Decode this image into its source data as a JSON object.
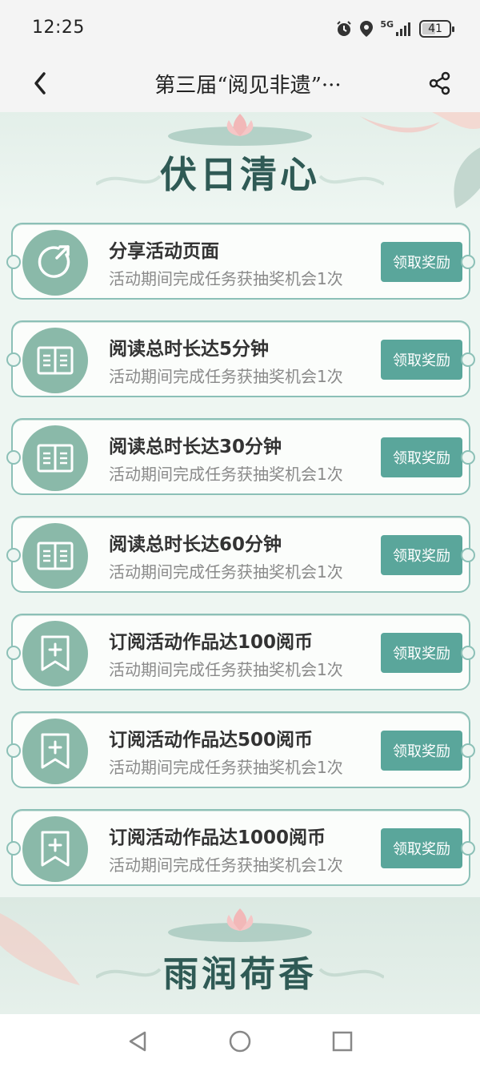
{
  "status_bar": {
    "time": "12:25",
    "network": "5G",
    "battery": "41"
  },
  "nav": {
    "title": "第三届“阅见非遗”···",
    "back_icon": "chevron-left-icon",
    "share_icon": "share-icon"
  },
  "banner_top": {
    "title": "伏日清心"
  },
  "tasks": [
    {
      "title": "分享活动页面",
      "desc": "活动期间完成任务获抽奖机会1次",
      "button": "领取奖励",
      "icon": "share-circle-icon"
    },
    {
      "title": "阅读总时长达5分钟",
      "desc": "活动期间完成任务获抽奖机会1次",
      "button": "领取奖励",
      "icon": "book-icon"
    },
    {
      "title": "阅读总时长达30分钟",
      "desc": "活动期间完成任务获抽奖机会1次",
      "button": "领取奖励",
      "icon": "book-icon"
    },
    {
      "title": "阅读总时长达60分钟",
      "desc": "活动期间完成任务获抽奖机会1次",
      "button": "领取奖励",
      "icon": "book-icon"
    },
    {
      "title": "订阅活动作品达100阅币",
      "desc": "活动期间完成任务获抽奖机会1次",
      "button": "领取奖励",
      "icon": "bookmark-plus-icon"
    },
    {
      "title": "订阅活动作品达500阅币",
      "desc": "活动期间完成任务获抽奖机会1次",
      "button": "领取奖励",
      "icon": "bookmark-plus-icon"
    },
    {
      "title": "订阅活动作品达1000阅币",
      "desc": "活动期间完成任务获抽奖机会1次",
      "button": "领取奖励",
      "icon": "bookmark-plus-icon"
    }
  ],
  "banner_bottom": {
    "title": "雨润荷香"
  },
  "colors": {
    "accent": "#5aa69b",
    "icon_bg": "#8ab9a9",
    "card_border": "#8cc0b7",
    "title_green": "#2f5a55"
  }
}
